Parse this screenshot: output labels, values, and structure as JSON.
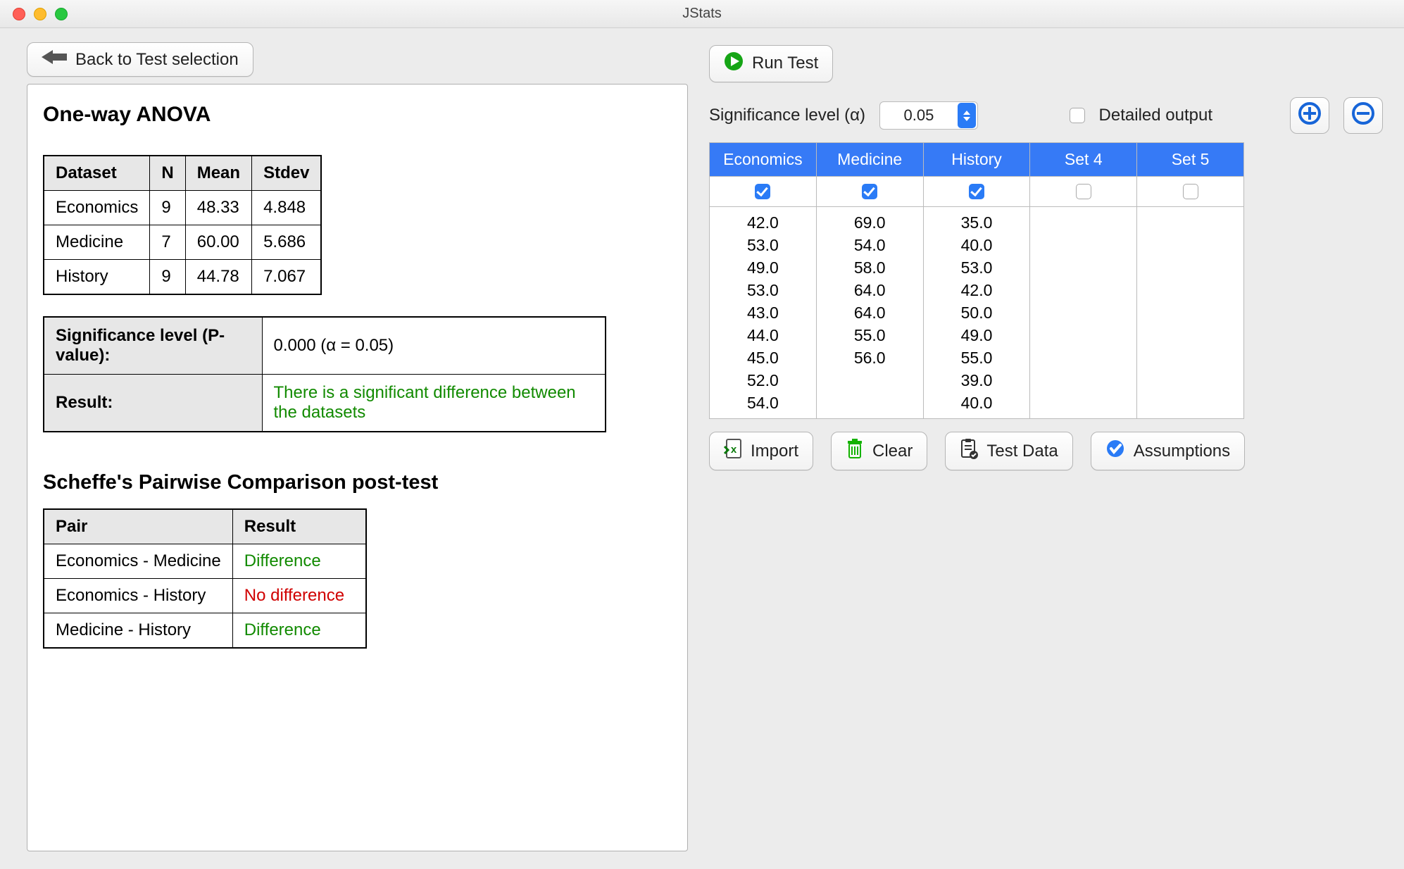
{
  "window_title": "JStats",
  "back_label": "Back to Test selection",
  "run_label": "Run Test",
  "sig_label": "Significance level (α)",
  "sig_value": "0.05",
  "detailed_label": "Detailed output",
  "anova": {
    "heading": "One-way ANOVA",
    "cols": [
      "Dataset",
      "N",
      "Mean",
      "Stdev"
    ],
    "rows": [
      [
        "Economics",
        "9",
        "48.33",
        "4.848"
      ],
      [
        "Medicine",
        "7",
        "60.00",
        "5.686"
      ],
      [
        "History",
        "9",
        "44.78",
        "7.067"
      ]
    ],
    "pvalue_label": "Significance level (P-value):",
    "pvalue_text": "0.000  (α = 0.05)",
    "result_label": "Result:",
    "result_text": "There is a significant difference between the datasets"
  },
  "scheffe": {
    "heading": "Scheffe's Pairwise Comparison post-test",
    "cols": [
      "Pair",
      "Result"
    ],
    "rows": [
      {
        "pair": "Economics - Medicine",
        "result": "Difference",
        "cls": "green-text"
      },
      {
        "pair": "Economics - History",
        "result": "No difference",
        "cls": "red-text"
      },
      {
        "pair": "Medicine - History",
        "result": "Difference",
        "cls": "green-text"
      }
    ]
  },
  "datasets": [
    {
      "name": "Economics",
      "checked": true,
      "values": [
        "42.0",
        "53.0",
        "49.0",
        "53.0",
        "43.0",
        "44.0",
        "45.0",
        "52.0",
        "54.0"
      ]
    },
    {
      "name": "Medicine",
      "checked": true,
      "values": [
        "69.0",
        "54.0",
        "58.0",
        "64.0",
        "64.0",
        "55.0",
        "56.0"
      ]
    },
    {
      "name": "History",
      "checked": true,
      "values": [
        "35.0",
        "40.0",
        "53.0",
        "42.0",
        "50.0",
        "49.0",
        "55.0",
        "39.0",
        "40.0"
      ]
    },
    {
      "name": "Set 4",
      "checked": false,
      "values": []
    },
    {
      "name": "Set 5",
      "checked": false,
      "values": []
    }
  ],
  "bottom": {
    "import": "Import",
    "clear": "Clear",
    "testdata": "Test Data",
    "assumptions": "Assumptions"
  }
}
